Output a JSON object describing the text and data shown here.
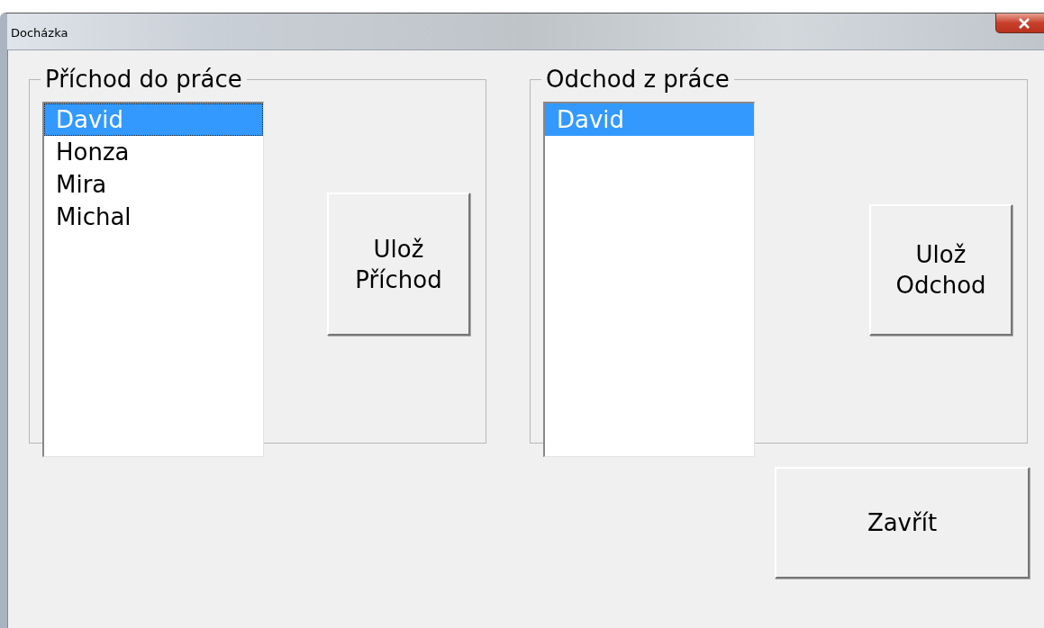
{
  "window": {
    "title": "Docházka"
  },
  "groups": [
    {
      "title": "Příchod do práce",
      "items": [
        {
          "label": "David",
          "selected": true
        },
        {
          "label": "Honza",
          "selected": false
        },
        {
          "label": "Mira",
          "selected": false
        },
        {
          "label": "Michal",
          "selected": false
        }
      ],
      "button": [
        "Ulož",
        "Příchod"
      ]
    },
    {
      "title": "Odchod z práce",
      "items": [
        {
          "label": "David",
          "selected": true
        }
      ],
      "button": [
        "Ulož",
        "Odchod"
      ]
    }
  ],
  "close_button": "Zavřít"
}
